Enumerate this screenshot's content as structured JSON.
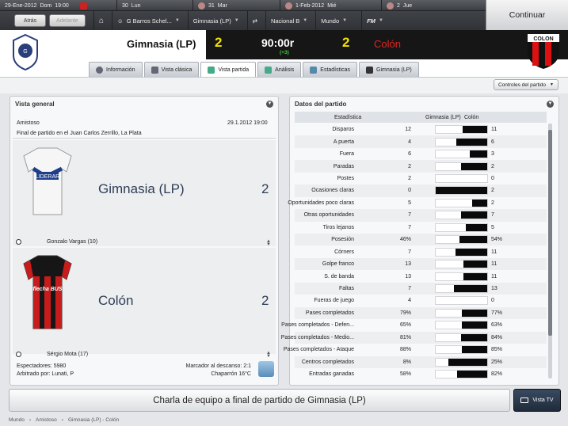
{
  "topbar": {
    "dates": [
      {
        "label": "29-Ene-2012",
        "day": "Dom",
        "time": "19:00",
        "badge": "#cc2222"
      },
      {
        "label": "30",
        "day": "Lun",
        "badge": ""
      },
      {
        "label": "31",
        "day": "Mar",
        "badge": ""
      },
      {
        "label": "1-Feb-2012",
        "day": "Mié",
        "badge": ""
      },
      {
        "label": "2",
        "day": "Jue",
        "badge": ""
      }
    ],
    "back_label": "Atrás",
    "forward_label": "Adelante",
    "breadcrumbs": [
      "G Barros Schel...",
      "Gimnasia (LP)",
      "Nacional B",
      "Mundo"
    ],
    "fm_label": "FM",
    "continue_label": "Continuar"
  },
  "match": {
    "home_name": "Gimnasia (LP)",
    "home_score": "2",
    "clock": "90:00r",
    "clock_sub": "(+3)",
    "away_score": "2",
    "away_name": "Colón",
    "away_crest_text": "COLON"
  },
  "tabs": [
    {
      "label": "Información",
      "active": false
    },
    {
      "label": "Vista clásica",
      "active": false
    },
    {
      "label": "Vista partida",
      "active": true
    },
    {
      "label": "Análisis",
      "active": false
    },
    {
      "label": "Estadísticas",
      "active": false
    },
    {
      "label": "Gimnasia (LP)",
      "active": false
    }
  ],
  "controls_label": "Controles del partido",
  "overview": {
    "title": "Vista general",
    "competition": "Amistoso",
    "date": "29.1.2012 19:00",
    "venue": "Final de partido en el Juan Carlos Zerrillo, La Plata",
    "home_team": "Gimnasia (LP)",
    "home_score": "2",
    "home_sponsor": "LIDERAR",
    "home_scorer": "Gonzalo Vargas (10)",
    "away_team": "Colón",
    "away_score": "2",
    "away_sponsor": "flecha BUS",
    "away_scorer": "Sérgio Mota (17)",
    "spectators": "Espectadores: 5980",
    "referee": "Arbitrado por: Lunati, P",
    "halftime": "Marcador al descanso: 2:1",
    "weather": "Chaparrón 16°C"
  },
  "stats": {
    "title": "Datos del partido",
    "col_stat": "Estadística",
    "col_home": "Gimnasia (LP)",
    "col_away": "Colón",
    "rows": [
      {
        "label": "Disparos",
        "home": "12",
        "away": "11",
        "h": 12,
        "a": 11
      },
      {
        "label": "A puerta",
        "home": "4",
        "away": "6",
        "h": 4,
        "a": 6
      },
      {
        "label": "Fuera",
        "home": "6",
        "away": "3",
        "h": 6,
        "a": 3
      },
      {
        "label": "Paradas",
        "home": "2",
        "away": "2",
        "h": 2,
        "a": 2
      },
      {
        "label": "Postes",
        "home": "2",
        "away": "0",
        "h": 2,
        "a": 0
      },
      {
        "label": "Ocasiones claras",
        "home": "0",
        "away": "2",
        "h": 0,
        "a": 2
      },
      {
        "label": "Oportunidades poco claras",
        "home": "5",
        "away": "2",
        "h": 5,
        "a": 2
      },
      {
        "label": "Otras oportunidades",
        "home": "7",
        "away": "7",
        "h": 7,
        "a": 7
      },
      {
        "label": "Tiros lejanos",
        "home": "7",
        "away": "5",
        "h": 7,
        "a": 5
      },
      {
        "label": "Posesión",
        "home": "46%",
        "away": "54%",
        "h": 46,
        "a": 54
      },
      {
        "label": "Córners",
        "home": "7",
        "away": "11",
        "h": 7,
        "a": 11
      },
      {
        "label": "Golpe franco",
        "home": "13",
        "away": "11",
        "h": 13,
        "a": 11
      },
      {
        "label": "S. de banda",
        "home": "13",
        "away": "11",
        "h": 13,
        "a": 11
      },
      {
        "label": "Faltas",
        "home": "7",
        "away": "13",
        "h": 7,
        "a": 13
      },
      {
        "label": "Fueras de juego",
        "home": "4",
        "away": "0",
        "h": 4,
        "a": 0
      },
      {
        "label": "Pases completados",
        "home": "79%",
        "away": "77%",
        "h": 79,
        "a": 77
      },
      {
        "label": "Pases completados - Defen...",
        "home": "65%",
        "away": "63%",
        "h": 65,
        "a": 63
      },
      {
        "label": "Pases completados - Medio...",
        "home": "81%",
        "away": "84%",
        "h": 81,
        "a": 84
      },
      {
        "label": "Pases completados - Ataque",
        "home": "88%",
        "away": "85%",
        "h": 88,
        "a": 85
      },
      {
        "label": "Centros completados",
        "home": "8%",
        "away": "25%",
        "h": 8,
        "a": 25
      },
      {
        "label": "Entradas ganadas",
        "home": "58%",
        "away": "82%",
        "h": 58,
        "a": 82
      }
    ]
  },
  "team_talk_label": "Charla de equipo a final de partido de Gimnasia (LP)",
  "tv_label": "Vista TV",
  "statusbar": [
    "Mundo",
    "Amistoso",
    "Gimnasia (LP) - Colón"
  ],
  "colors": {
    "accent_yellow": "#f2e200",
    "away_red": "#e0241f",
    "bar_dark": "#0a0a0a"
  }
}
